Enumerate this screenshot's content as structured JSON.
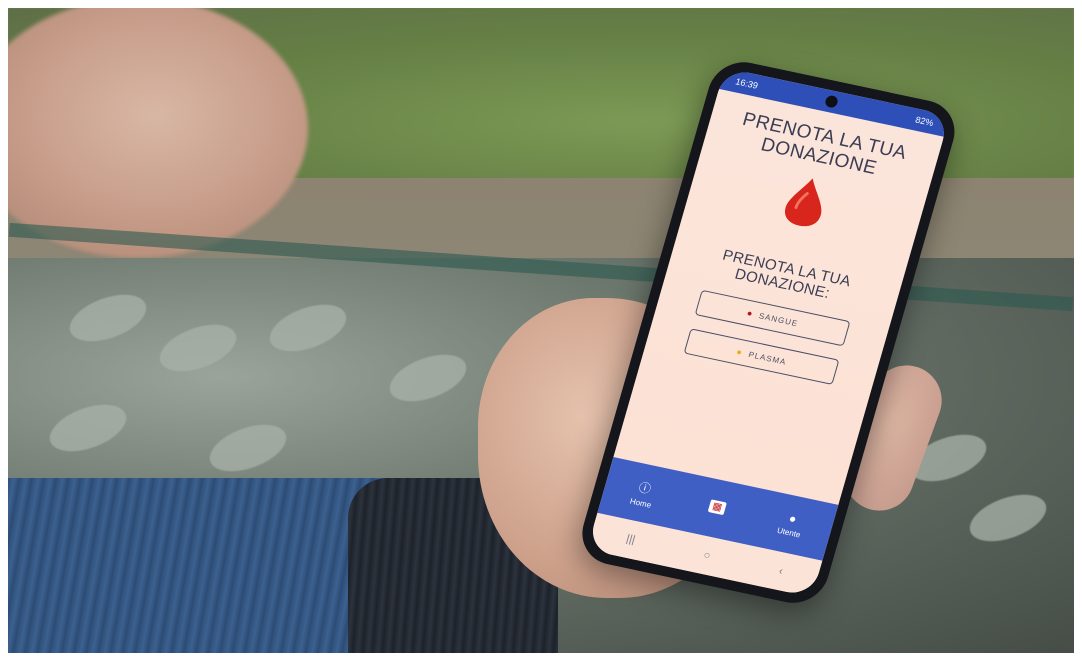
{
  "phone": {
    "status_time": "16:39",
    "status_battery": "82%",
    "title": "PRENOTA LA TUA DONAZIONE",
    "subtitle": "PRENOTA LA TUA DONAZIONE:",
    "buttons": [
      {
        "label": "SANGUE",
        "icon": "blood-drop-icon"
      },
      {
        "label": "PLASMA",
        "icon": "plasma-drop-icon"
      }
    ],
    "nav": [
      {
        "label": "Home",
        "icon": "info-icon"
      },
      {
        "label": "",
        "icon": "calendar-icon"
      },
      {
        "label": "Utente",
        "icon": "user-icon"
      }
    ],
    "system_nav": [
      "|||",
      "○",
      "‹"
    ]
  },
  "colors": {
    "accent_blue": "#3f5fc5",
    "screen_bg": "#fde1d3",
    "blood_red": "#d8261c"
  }
}
